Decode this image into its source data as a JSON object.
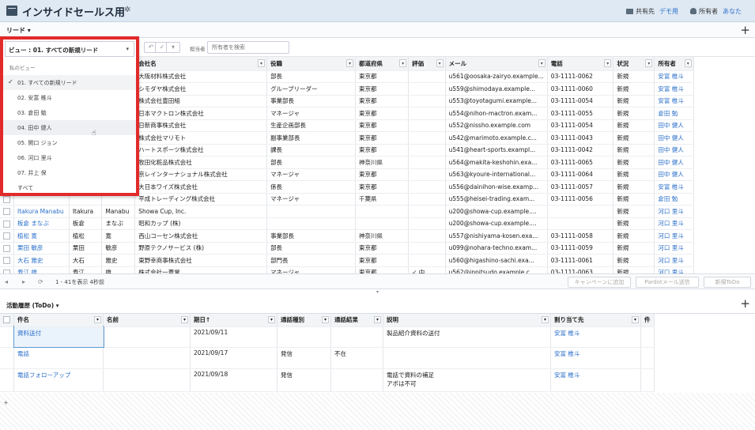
{
  "header": {
    "title": "インサイドセールス用",
    "share_label": "共有先",
    "share_value": "デモ用",
    "owner_label": "所有者",
    "owner_value": "あなた"
  },
  "tab": {
    "label": "リード ▾"
  },
  "toolbar": {
    "assignee_label": "担当者",
    "search_placeholder": "所有者を検索"
  },
  "view_dropdown": {
    "selected": "ビュー : 01. すべての新規リード",
    "group_label": "私のビュー",
    "items": [
      "01. すべての新規リード",
      "02. 安富 椎斗",
      "03. 倉田 勉",
      "04. 田中 健人",
      "05. 関口 ジョン",
      "06. 河口 里斗",
      "07. 井上 保",
      "すべて"
    ]
  },
  "leads": {
    "columns": [
      "会社名",
      "役職",
      "都道府県",
      "評価",
      "メール",
      "電話",
      "状況",
      "所有者"
    ],
    "rows": [
      {
        "company": "大阪材料株式会社",
        "title": "部長",
        "pref": "東京都",
        "rating": "",
        "email": "u561@oosaka-zairyo.example...",
        "phone": "03-1111-0062",
        "status": "新規",
        "owner": "安富 椎斗"
      },
      {
        "company": "シモダヤ株式会社",
        "title": "グループリーダー",
        "pref": "東京都",
        "rating": "",
        "email": "u559@shimodaya.example...",
        "phone": "03-1111-0060",
        "status": "新規",
        "owner": "安富 椎斗"
      },
      {
        "company": "株式会社豊田組",
        "title": "事業部長",
        "pref": "東京都",
        "rating": "",
        "email": "u553@toyotagumi.example...",
        "phone": "03-1111-0054",
        "status": "新規",
        "owner": "安富 椎斗"
      },
      {
        "company": "日本マクトロン株式会社",
        "title": "マネージャ",
        "pref": "東京都",
        "rating": "",
        "email": "u554@nihon-mactron.exam...",
        "phone": "03-1111-0055",
        "status": "新規",
        "owner": "倉田 勉"
      },
      {
        "company": "日新商事株式会社",
        "title": "生産企画部長",
        "pref": "東京都",
        "rating": "",
        "email": "u552@nissho.example.com",
        "phone": "03-1111-0054",
        "status": "新規",
        "owner": "田中 健人"
      },
      {
        "company": "株式会社マリモト",
        "title": "副事業部長",
        "pref": "東京都",
        "rating": "",
        "email": "u542@marimoto.example.c...",
        "phone": "03-1111-0043",
        "status": "新規",
        "owner": "田中 健人"
      },
      {
        "company": "ハートスポーツ株式会社",
        "title": "課長",
        "pref": "東京都",
        "rating": "",
        "email": "u541@heart-sports.exampl...",
        "phone": "03-1111-0042",
        "status": "新規",
        "owner": "田中 健人"
      },
      {
        "company": "牧田化粧品株式会社",
        "title": "部長",
        "pref": "神奈川県",
        "rating": "",
        "email": "u564@makita-keshohin.exa...",
        "phone": "03-1111-0065",
        "status": "新規",
        "owner": "田中 健人"
      },
      {
        "company": "京レインターナショナル株式会社",
        "title": "マネージャ",
        "pref": "東京都",
        "rating": "",
        "email": "u563@kyoure-international...",
        "phone": "03-1111-0064",
        "status": "新規",
        "owner": "田中 健人"
      },
      {
        "company": "大日本ワイズ株式会社",
        "title": "係長",
        "pref": "東京都",
        "rating": "",
        "email": "u556@dainihon-wise.examp...",
        "phone": "03-1111-0057",
        "status": "新規",
        "owner": "安富 椎斗"
      },
      {
        "company": "平成トレーディング株式会社",
        "title": "マネージャ",
        "pref": "千葉県",
        "rating": "",
        "email": "u555@heisei-trading.exam...",
        "phone": "03-1111-0056",
        "status": "新規",
        "owner": "倉田 勉"
      },
      {
        "name": "Itakura Manabu",
        "last": "Itakura",
        "first": "Manabu",
        "company": "Showa Cup, Inc.",
        "title": "",
        "pref": "",
        "rating": "",
        "email": "u200@showa-cup.example....",
        "phone": "",
        "status": "新規",
        "owner": "河口 里斗"
      },
      {
        "name": "板倉 まなぶ",
        "last": "板倉",
        "first": "まなぶ",
        "company": "昭和カップ (株)",
        "title": "",
        "pref": "",
        "rating": "",
        "email": "u200@showa-cup.example....",
        "phone": "",
        "status": "新規",
        "owner": "河口 里斗"
      },
      {
        "name": "植松 寛",
        "last": "植松",
        "first": "寛",
        "company": "西山コーセン株式会社",
        "title": "事業部長",
        "pref": "神奈川県",
        "rating": "",
        "email": "u557@nishiyama-kosen.exa...",
        "phone": "03-1111-0058",
        "status": "新規",
        "owner": "河口 里斗"
      },
      {
        "name": "栗田 敏彦",
        "last": "栗田",
        "first": "敏彦",
        "company": "野原テクノサービス (株)",
        "title": "部長",
        "pref": "東京都",
        "rating": "",
        "email": "u099@nohara-techno.exam...",
        "phone": "03-1111-0059",
        "status": "新規",
        "owner": "河口 里斗"
      },
      {
        "name": "大石 雅史",
        "last": "大石",
        "first": "雅史",
        "company": "東野幸商事株式会社",
        "title": "部門長",
        "pref": "東京都",
        "rating": "",
        "email": "u560@higashino-sachi.exa...",
        "phone": "03-1111-0061",
        "status": "新規",
        "owner": "河口 里斗"
      },
      {
        "name": "寿江 雄",
        "last": "寿江",
        "first": "雄",
        "company": "株式会社一菱堂",
        "title": "マネージャ",
        "pref": "東京都",
        "rating": "✓ 中",
        "email": "u562@ippitsudo.example.c...",
        "phone": "03-1111-0063",
        "status": "新規",
        "owner": "河口 里斗"
      }
    ]
  },
  "pager": {
    "info": "1 - 41を表示 4秒前",
    "btn_campaign": "キャンペーンに追加",
    "btn_pardot": "Pardotメール送信",
    "btn_todo": "新規ToDo"
  },
  "activities": {
    "tab": "活動履歴 (ToDo) ▾",
    "columns": [
      "件名",
      "名前",
      "期日↑",
      "通話種別",
      "通話結果",
      "説明",
      "割り当て先",
      "件"
    ],
    "rows": [
      {
        "subject": "資料送付",
        "name": "",
        "date": "2021/09/11",
        "calltype": "",
        "result": "",
        "desc": "製品紹介資料の送付",
        "assignee": "安富 椎斗"
      },
      {
        "subject": "電話",
        "name": "",
        "date": "2021/09/17",
        "calltype": "発信",
        "result": "不在",
        "desc": "",
        "assignee": "安富 椎斗"
      },
      {
        "subject": "電話フォローアップ",
        "name": "",
        "date": "2021/09/18",
        "calltype": "発信",
        "result": "",
        "desc": "電話で資料の補足\nアポは不可",
        "assignee": "安富 椎斗"
      }
    ]
  }
}
